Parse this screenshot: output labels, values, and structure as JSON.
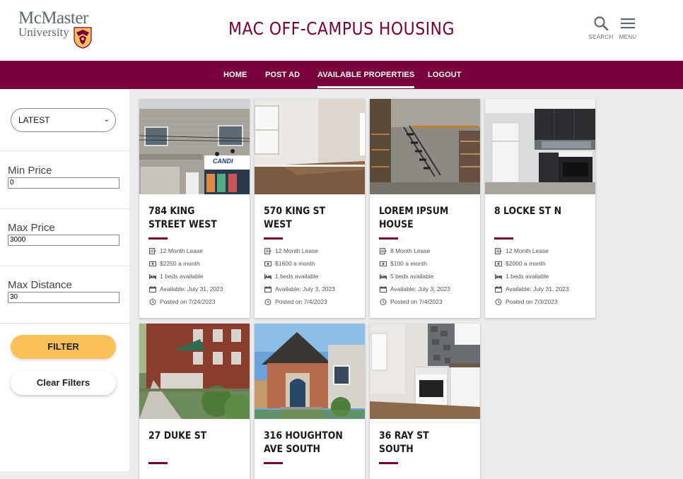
{
  "header": {
    "logo_line1": "McMaster",
    "logo_line2": "University",
    "site_title": "MAC OFF-CAMPUS HOUSING",
    "search_label": "SEARCH",
    "menu_label": "MENU"
  },
  "nav": {
    "items": [
      {
        "label": "HOME"
      },
      {
        "label": "POST AD"
      },
      {
        "label": "AVAILABLE PROPERTIES",
        "active": true
      },
      {
        "label": "LOGOUT"
      }
    ]
  },
  "filters": {
    "sort_value": "LATEST",
    "min_price_label": "Min Price",
    "min_price_value": "0",
    "max_price_label": "Max Price",
    "max_price_value": "3000",
    "max_distance_label": "Max Distance",
    "max_distance_value": "30",
    "filter_button": "FILTER",
    "clear_button": "Clear Filters"
  },
  "listings": [
    {
      "title": "784 KING STREET WEST",
      "lease": "12 Month Lease",
      "price": "$2250 a month",
      "beds": "1 beds available",
      "available": "Available: July 31, 2023",
      "posted": "Posted on 7/24/2023"
    },
    {
      "title": "570 KING ST WEST",
      "lease": "12 Month Lease",
      "price": "$1600 a month",
      "beds": "1 beds available",
      "available": "Available: July 3, 2023",
      "posted": "Posted on 7/4/2023"
    },
    {
      "title": "LOREM IPSUM HOUSE",
      "lease": "8 Month Lease",
      "price": "$100 a month",
      "beds": "5 beds available",
      "available": "Available: July 3, 2023",
      "posted": "Posted on 7/4/2023"
    },
    {
      "title": "8 LOCKE ST N",
      "lease": "12 Month Lease",
      "price": "$2000 a month",
      "beds": "1 beds available",
      "available": "Available: July 31, 2023",
      "posted": "Posted on 7/3/2023"
    },
    {
      "title": "27 DUKE ST"
    },
    {
      "title": "316 HOUGHTON AVE SOUTH"
    },
    {
      "title": "36 RAY ST SOUTH"
    }
  ],
  "store_sign": "CANDI",
  "colors": {
    "maroon": "#7a003c",
    "gold": "#fdbf57",
    "grey": "#5e6a71"
  }
}
